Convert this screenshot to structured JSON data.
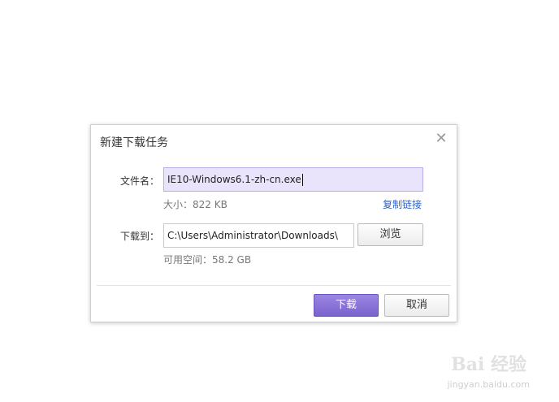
{
  "dialog": {
    "title": "新建下载任务",
    "close_icon": "close-icon",
    "filename_label": "文件名：",
    "filename_value": "IE10-Windows6.1-zh-cn.exe",
    "size_text": "大小：822 KB",
    "copy_link": "复制链接",
    "save_to_label": "下载到：",
    "path_value": "C:\\Users\\Administrator\\Downloads\\",
    "browse_label": "浏览",
    "free_space_text": "可用空间：58.2 GB",
    "download_label": "下载",
    "cancel_label": "取消"
  },
  "watermark": {
    "logo_text": "Bai 经验",
    "url_text": "jingyan.baidu.com"
  },
  "colors": {
    "primary": "#7b62cf",
    "link": "#2d63c8",
    "filename_bg": "#e9e4fb"
  }
}
